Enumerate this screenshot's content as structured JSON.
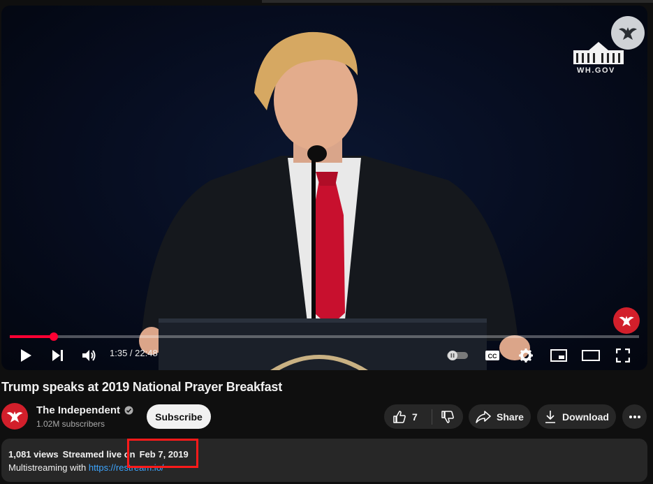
{
  "video": {
    "watermark_text": "WH.GOV",
    "time_current": "1:35",
    "time_separator": " / ",
    "time_total": "22:48",
    "progress": 0.07
  },
  "title": "Trump speaks at 2019 National Prayer Breakfast",
  "channel": {
    "name": "The Independent",
    "subscribers": "1.02M subscribers",
    "subscribe_label": "Subscribe"
  },
  "actions": {
    "like_count": "7",
    "share_label": "Share",
    "download_label": "Download"
  },
  "description": {
    "views": "1,081 views",
    "streamed_prefix": "Streamed live on",
    "date": "Feb 7, 2019",
    "line_prefix": "Multistreaming with",
    "link_text": "https://restream.io/"
  },
  "colors": {
    "accent": "#ff0033",
    "highlight": "#ff1a1a",
    "link": "#3ea6ff"
  }
}
